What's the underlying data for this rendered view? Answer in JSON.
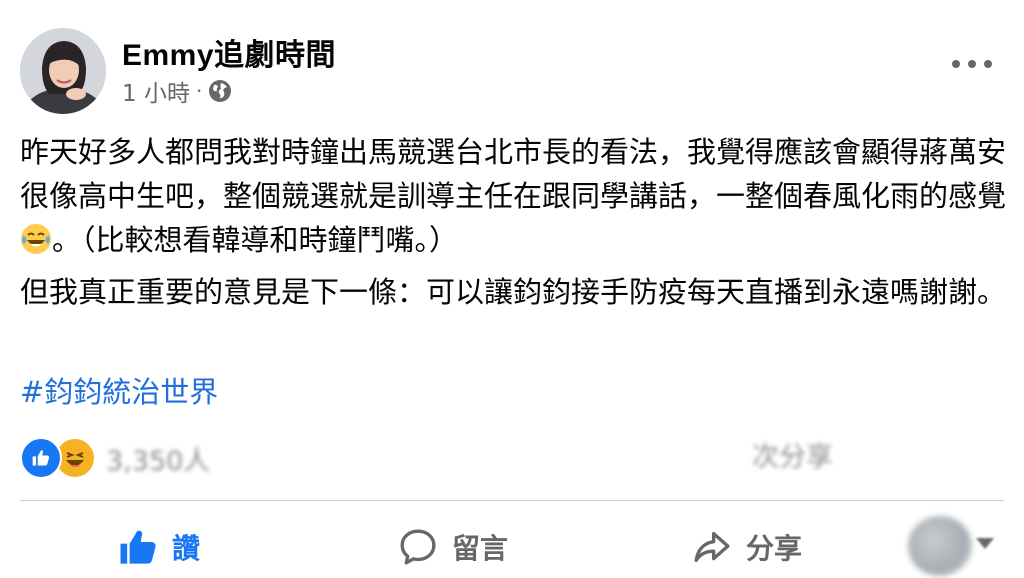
{
  "post": {
    "author": "Emmy追劇時間",
    "time": "1 小時",
    "separator": "·",
    "privacy_icon": "globe-icon",
    "paragraph1_before_emoji": "昨天好多人都問我對時鐘出馬競選台北市長的看法，我覺得應該會顯得蔣萬安很像高中生吧，整個競選就是訓導主任在跟同學講話，一整個春風化雨的感覺",
    "paragraph1_emoji": "tears-of-joy-emoji",
    "paragraph1_after_emoji": "。（比較想看韓導和時鐘鬥嘴。）",
    "paragraph2": "但我真正重要的意見是下一條：可以讓鈞鈞接手防疫每天直播到永遠嗎謝謝。",
    "hashtag": "#鈞鈞統治世界"
  },
  "reactions": {
    "icons": [
      "like-reaction-icon",
      "haha-reaction-icon"
    ],
    "summary_text": "3,350人",
    "shares_text": "次分享"
  },
  "actions": {
    "like_label": "讚",
    "comment_label": "留言",
    "share_label": "分享"
  },
  "colors": {
    "accent": "#1877f2",
    "hashtag": "#216fdb",
    "secondary_text": "#65676b",
    "divider": "#ced0d4"
  }
}
